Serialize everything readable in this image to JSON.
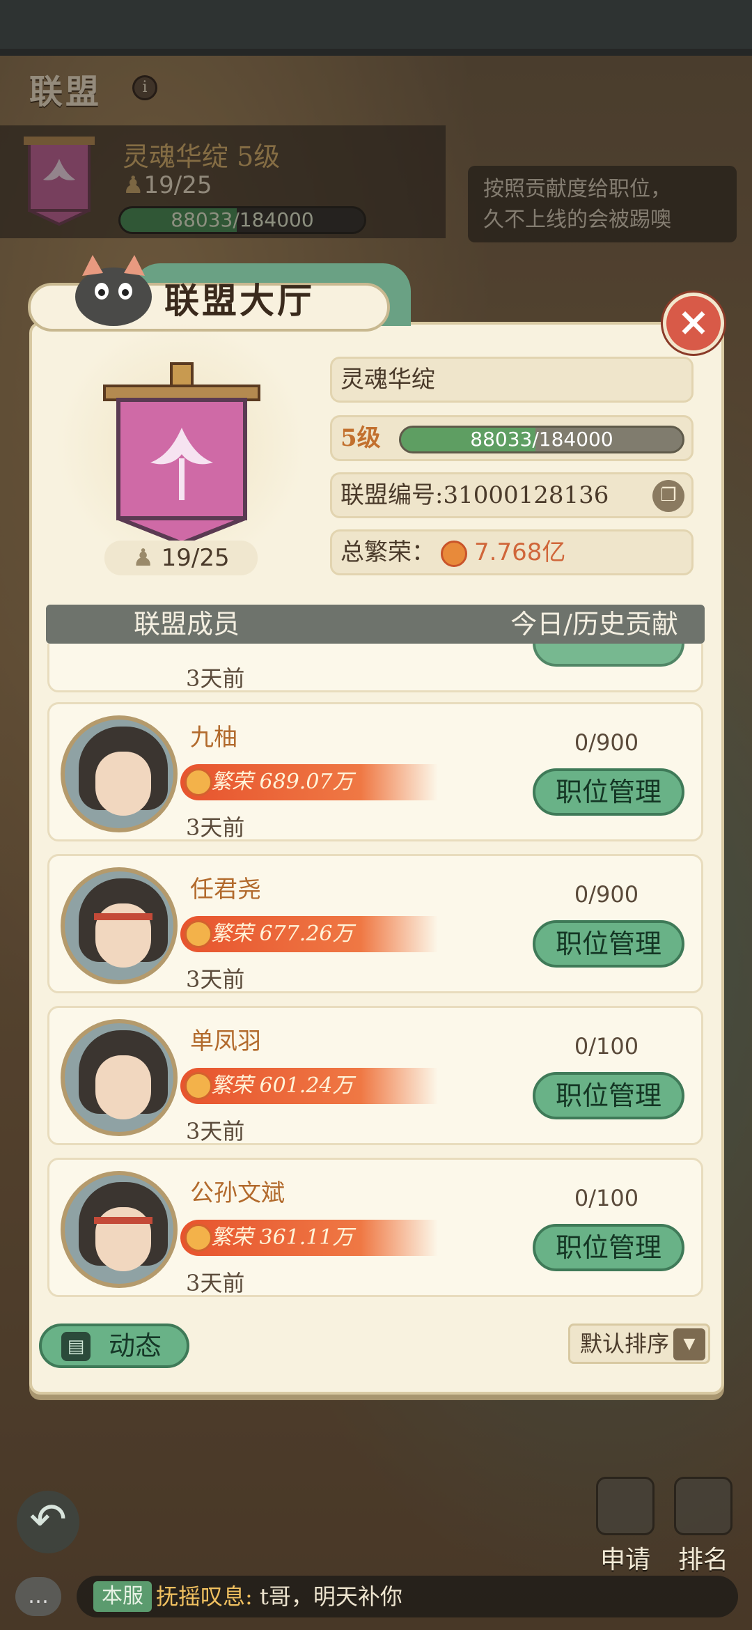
{
  "header": {
    "title": "联盟",
    "info_icon": "info-icon",
    "alliance_name_level": "灵魂华绽 5级",
    "member_count": "19/25",
    "progress_text": "88033/184000",
    "progress_fraction": 0.478,
    "tip_line1": "按照贡献度给职位，",
    "tip_line2": "久不上线的会被踢噢"
  },
  "panel": {
    "title": "联盟大厅",
    "close_icon": "close-icon",
    "member_count": "19/25",
    "name": "灵魂华绽",
    "level_label": "5级",
    "level_progress_text": "88033/184000",
    "level_progress_fraction": 0.478,
    "id_text": "联盟编号:31000128136",
    "prosperity_label": "总繁荣：",
    "prosperity_value": "7.768亿"
  },
  "list": {
    "header_left": "联盟成员",
    "header_right": "今日/历史贡献",
    "partial_time": "3天前",
    "members": [
      {
        "name": "九柚",
        "prosperity": "繁荣 689.07万",
        "time": "3天前",
        "contribution": "0/900",
        "button": "职位管理"
      },
      {
        "name": "任君尧",
        "prosperity": "繁荣 677.26万",
        "time": "3天前",
        "contribution": "0/900",
        "button": "职位管理"
      },
      {
        "name": "单凤羽",
        "prosperity": "繁荣 601.24万",
        "time": "3天前",
        "contribution": "0/100",
        "button": "职位管理"
      },
      {
        "name": "公孙文斌",
        "prosperity": "繁荣 361.11万",
        "time": "3天前",
        "contribution": "0/100",
        "button": "职位管理"
      }
    ]
  },
  "footer": {
    "dynamics_label": "动态",
    "sort_label": "默认排序"
  },
  "bottom": {
    "apply_label": "申请",
    "rank_label": "排名",
    "chat_tag": "本服",
    "chat_sender": "抚摇叹息:",
    "chat_text": " t哥，明天补你"
  }
}
